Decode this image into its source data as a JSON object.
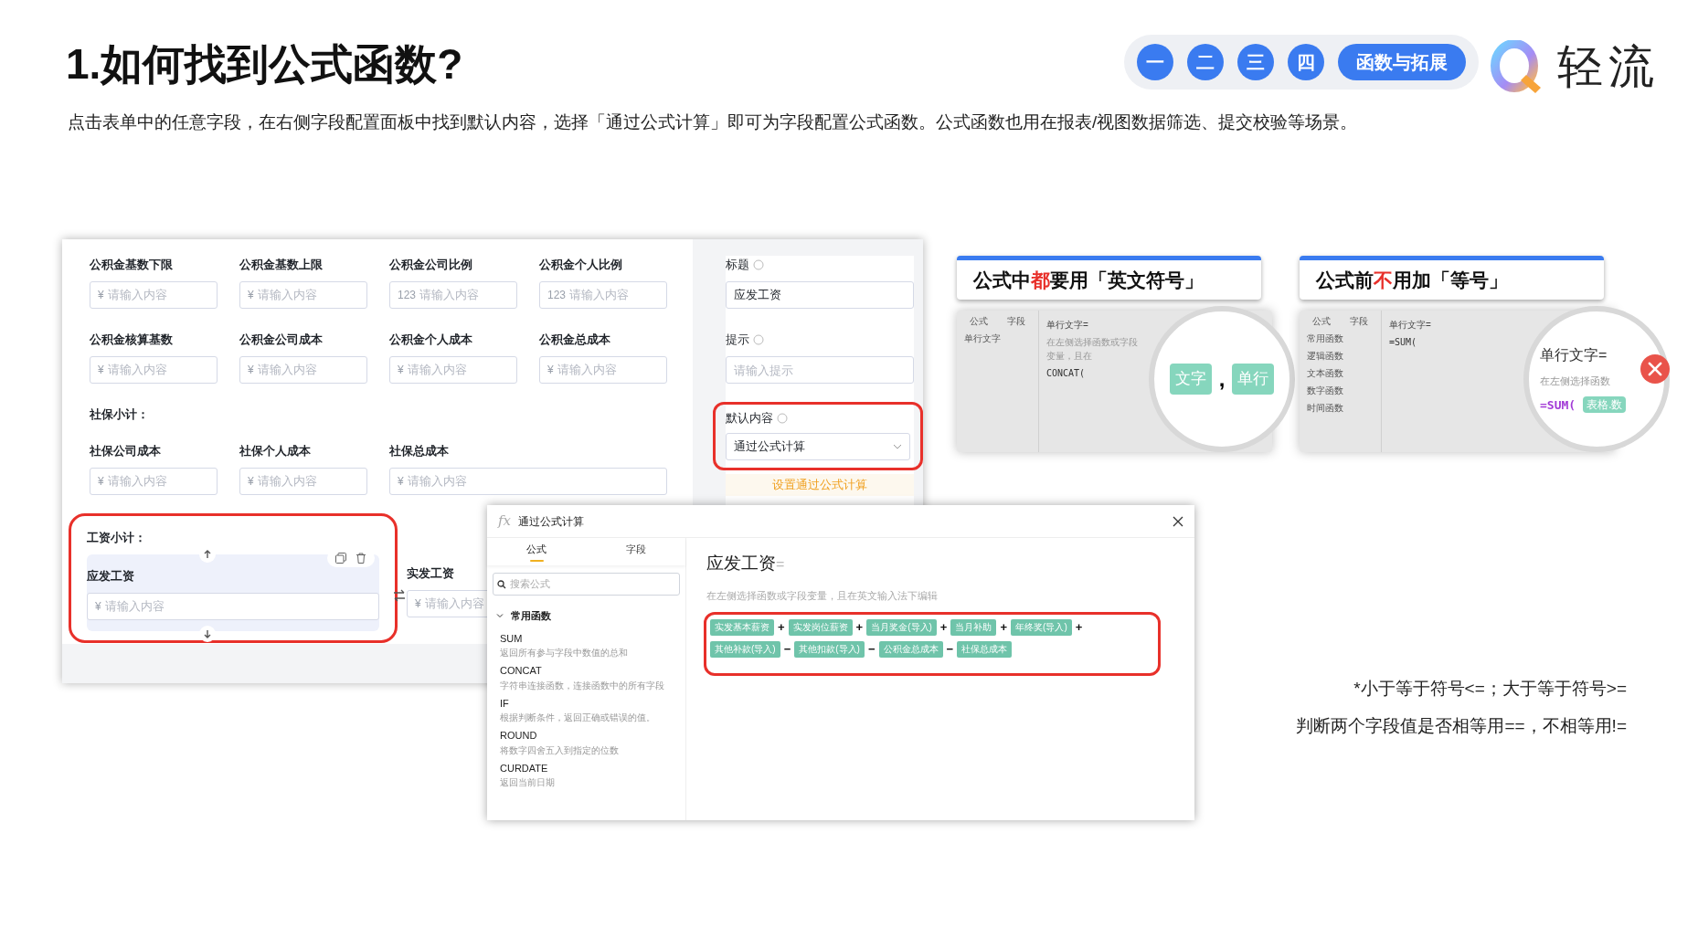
{
  "title": "1.如何找到公式函数?",
  "nav": [
    {
      "label": "一",
      "kind": "circle"
    },
    {
      "label": "二",
      "kind": "circle"
    },
    {
      "label": "三",
      "kind": "circle"
    },
    {
      "label": "四",
      "kind": "circle"
    },
    {
      "label": "函数与拓展",
      "kind": "pill"
    }
  ],
  "logo": {
    "text": "轻流"
  },
  "intro": "点击表单中的任意字段，在右侧字段配置面板中找到默认内容，选择「通过公式计算」即可为字段配置公式函数。公式函数也用在报表/视图数据筛选、提交校验等场景。",
  "form": {
    "rows": [
      [
        {
          "label": "公积金基数下限",
          "prefix": "¥",
          "placeholder": "请输入内容"
        },
        {
          "label": "公积金基数上限",
          "prefix": "¥",
          "placeholder": "请输入内容"
        },
        {
          "label": "公积金公司比例",
          "prefix": "123",
          "placeholder": "请输入内容"
        },
        {
          "label": "公积金个人比例",
          "prefix": "123",
          "placeholder": "请输入内容"
        }
      ],
      [
        {
          "label": "公积金核算基数",
          "prefix": "¥",
          "placeholder": "请输入内容"
        },
        {
          "label": "公积金公司成本",
          "prefix": "¥",
          "placeholder": "请输入内容"
        },
        {
          "label": "公积金个人成本",
          "prefix": "¥",
          "placeholder": "请输入内容"
        },
        {
          "label": "公积金总成本",
          "prefix": "¥",
          "placeholder": "请输入内容"
        }
      ]
    ],
    "social": {
      "heading": "社保小计：",
      "fields": [
        {
          "label": "社保公司成本",
          "prefix": "¥",
          "placeholder": "请输入内容"
        },
        {
          "label": "社保个人成本",
          "prefix": "¥",
          "placeholder": "请输入内容"
        },
        {
          "label": "社保总成本",
          "prefix": "¥",
          "placeholder": "请输入内容"
        }
      ]
    },
    "wage": {
      "heading": "工资小计：",
      "fields": [
        {
          "label": "应发工资",
          "prefix": "¥",
          "placeholder": "请输入内容",
          "selected": true
        },
        {
          "label": "实发工资",
          "prefix": "¥",
          "placeholder": "请输入内容",
          "selected": false
        }
      ]
    }
  },
  "config": {
    "title_label": "标题",
    "title_value": "应发工资",
    "hint_label": "提示",
    "hint_placeholder": "请输入提示",
    "default_label": "默认内容",
    "default_value": "通过公式计算",
    "action": "设置通过公式计算"
  },
  "dialog": {
    "icon_text": "fx",
    "title": "通过公式计算",
    "tabs": [
      {
        "label": "公式",
        "selected": true
      },
      {
        "label": "字段",
        "selected": false
      }
    ],
    "search_placeholder": "搜索公式",
    "group": {
      "label": "常用函数",
      "expanded": true
    },
    "functions": [
      {
        "name": "SUM",
        "desc": "返回所有参与字段中数值的总和"
      },
      {
        "name": "CONCAT",
        "desc": "字符串连接函数，连接函数中的所有字段"
      },
      {
        "name": "IF",
        "desc": "根据判断条件，返回正确或错误的值。"
      },
      {
        "name": "ROUND",
        "desc": "将数字四舍五入到指定的位数"
      },
      {
        "name": "CURDATE",
        "desc": "返回当前日期"
      }
    ],
    "field_name": "应发工资",
    "equals": "=",
    "hint": "在左侧选择函数或字段变量，且在英文输入法下编辑",
    "formula": [
      {
        "kind": "field",
        "text": "实发基本薪资"
      },
      {
        "kind": "operator",
        "text": "+"
      },
      {
        "kind": "field",
        "text": "实发岗位薪资"
      },
      {
        "kind": "operator",
        "text": "+"
      },
      {
        "kind": "field",
        "text": "当月奖金(导入)"
      },
      {
        "kind": "operator",
        "text": "+"
      },
      {
        "kind": "field",
        "text": "当月补助"
      },
      {
        "kind": "operator",
        "text": "+"
      },
      {
        "kind": "field",
        "text": "年终奖(导入)"
      },
      {
        "kind": "operator",
        "text": "+"
      },
      {
        "kind": "field",
        "text": "其他补款(导入)"
      },
      {
        "kind": "operator",
        "text": "−"
      },
      {
        "kind": "field",
        "text": "其他扣款(导入)"
      },
      {
        "kind": "operator",
        "text": "−"
      },
      {
        "kind": "field",
        "text": "公积金总成本"
      },
      {
        "kind": "operator",
        "text": "−"
      },
      {
        "kind": "field",
        "text": "社保总成本"
      }
    ]
  },
  "tips": [
    {
      "title_start": "公式中",
      "title_emphasis": "都",
      "title_end": "要用「英文符号」",
      "example": {
        "tabs": [
          "公式",
          "字段"
        ],
        "items": [
          "单行文字"
        ],
        "field": "单行文字=",
        "hint": "在左侧选择函数或字段变量，且在",
        "code": "CONCAT(",
        "lens": [
          {
            "kind": "token",
            "text": "文字"
          },
          {
            "kind": "symbol",
            "text": ","
          },
          {
            "kind": "token",
            "text": "单行"
          }
        ]
      },
      "wrong": false
    },
    {
      "title_start": "公式前",
      "title_emphasis": "不",
      "title_end": "用加「等号」",
      "example": {
        "tabs": [
          "公式",
          "字段"
        ],
        "items": [
          "常用函数",
          "逻辑函数",
          "文本函数",
          "数字函数",
          "时间函数"
        ],
        "field": "单行文字=",
        "code": "=SUM(",
        "lens": [
          {
            "kind": "heading",
            "text": "单行文字="
          },
          {
            "kind": "hint",
            "text": "在左侧选择函数"
          },
          {
            "kind": "code",
            "text": "=SUM("
          },
          {
            "kind": "token",
            "text": "表格.数"
          }
        ]
      },
      "wrong": true
    }
  ],
  "notes": [
    "*小于等于符号<=；大于等于符号>=",
    "判断两个字段值是否相等用==，不相等用!="
  ]
}
